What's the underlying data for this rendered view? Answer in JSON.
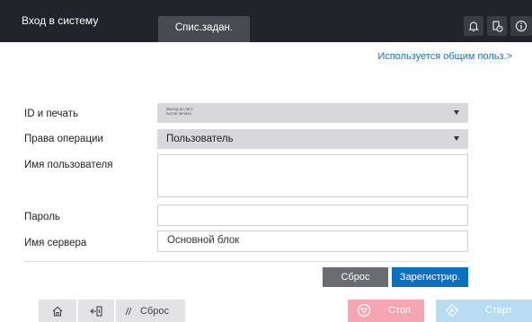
{
  "header": {
    "title": "Вход в систему",
    "tab_label": "Спис.задан.",
    "icons": [
      "bell-icon",
      "device-icon",
      "info-icon"
    ]
  },
  "shared_link": "Используется общим польз.>",
  "form": {
    "id_print": {
      "label": "ID и печать",
      "value_line1": "Выход из сист.",
      "value_line2": "после печати"
    },
    "rights": {
      "label": "Права операции",
      "value": "Пользователь"
    },
    "username": {
      "label": "Имя пользователя",
      "value": ""
    },
    "password": {
      "label": "Пароль",
      "value": ""
    },
    "server": {
      "label": "Имя сервера",
      "value": "Основной блок"
    }
  },
  "actions": {
    "reset": "Сброс",
    "register": "Зарегистрир."
  },
  "bottom": {
    "reset": "Сброс",
    "stop": "Стоп",
    "start": "Старт",
    "colors": {
      "stop": "#f6a6b3",
      "start": "#b8ddf3"
    }
  },
  "colors": {
    "topbar": "#23232b",
    "accent": "#0f6fbf",
    "link": "#1f6fbf"
  }
}
